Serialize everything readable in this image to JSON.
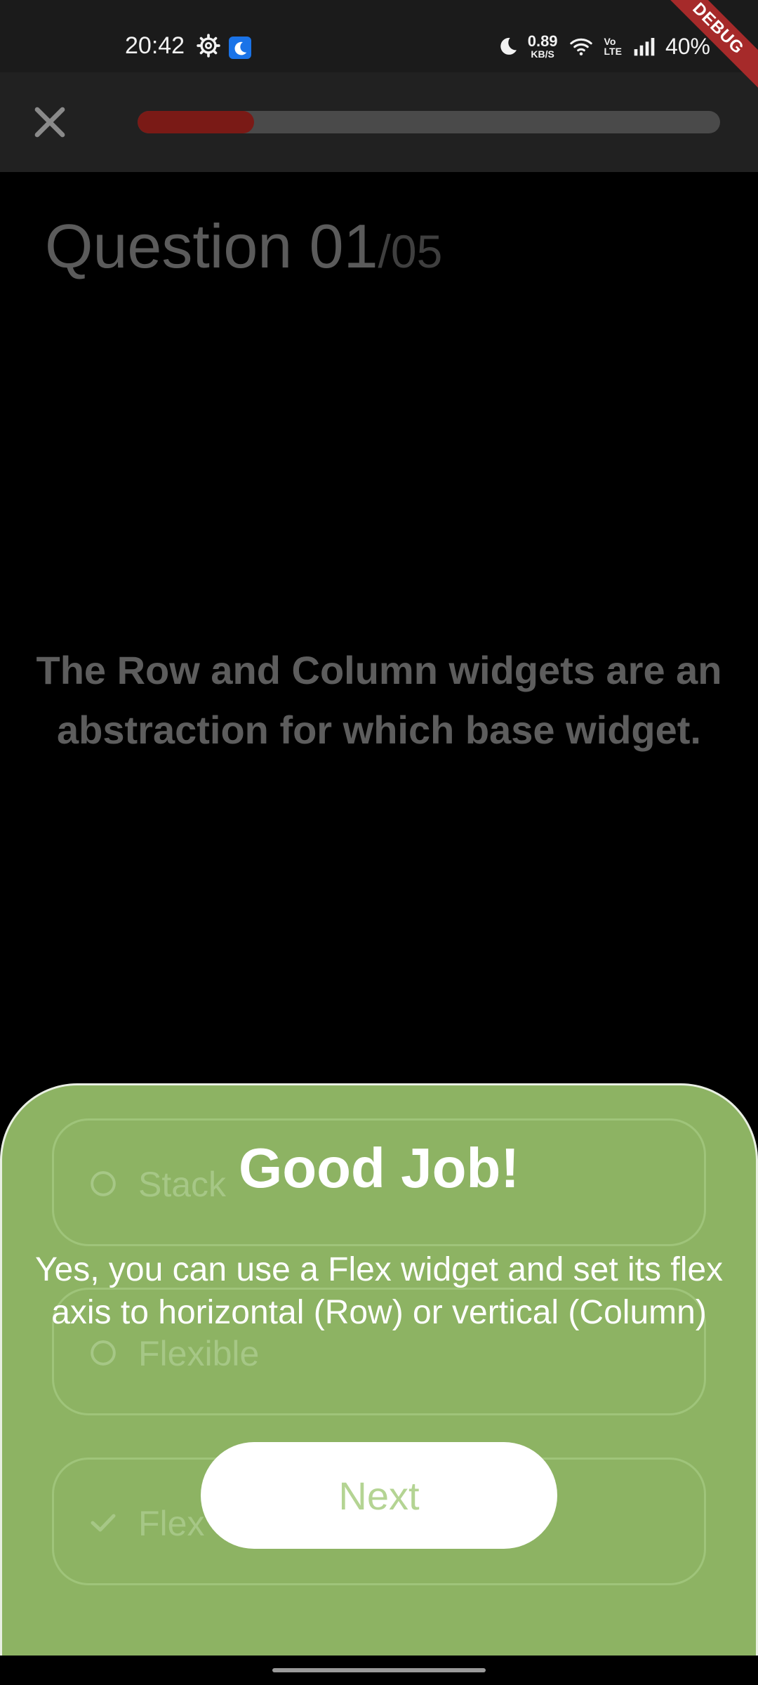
{
  "status_bar": {
    "time": "20:42",
    "net_speed_value": "0.89",
    "net_speed_unit": "KB/S",
    "volte_top": "Vo",
    "volte_bottom": "LTE",
    "battery": "40%",
    "debug_label": "DEBUG",
    "icons": [
      "gear-icon",
      "moon-app-icon",
      "moon-icon",
      "wifi-icon",
      "signal-icon"
    ]
  },
  "app_bar": {
    "close_icon": "close-icon",
    "progress": 0.2,
    "progress_color": "#7a1a16"
  },
  "question": {
    "current": "Question 01",
    "total": "/05",
    "text": "The Row and Column widgets are an abstraction for which base widget."
  },
  "options": [
    {
      "label": "Stack",
      "icon": "radio-icon"
    },
    {
      "label": "Flexible",
      "icon": "radio-icon"
    },
    {
      "label": "Flex",
      "icon": "check-icon"
    }
  ],
  "feedback": {
    "title": "Good Job!",
    "message": "Yes, you can use a Flex widget and set its flex axis to horizontal (Row) or vertical (Column)",
    "next_label": "Next",
    "accent_color": "#8db363"
  }
}
